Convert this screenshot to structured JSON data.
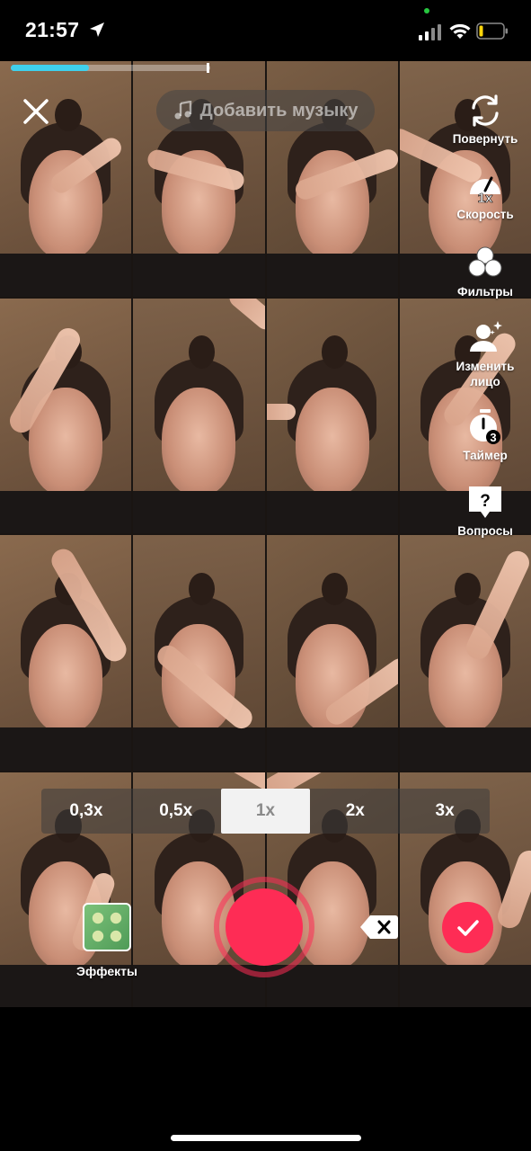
{
  "status_bar": {
    "time": "21:57"
  },
  "recording": {
    "progress_fraction": 0.39
  },
  "top": {
    "music_label": "Добавить музыку"
  },
  "tools": [
    {
      "label": "Повернуть",
      "icon": "flip-camera-icon"
    },
    {
      "label": "Скорость",
      "icon": "speed-icon",
      "badge": "1x"
    },
    {
      "label": "Фильтры",
      "icon": "filters-icon"
    },
    {
      "label": "Изменить лицо",
      "icon": "face-change-icon"
    },
    {
      "label": "Таймер",
      "icon": "timer-icon",
      "badge": "3"
    },
    {
      "label": "Вопросы",
      "icon": "questions-icon",
      "badge": "?"
    }
  ],
  "speed_options": [
    "0,3x",
    "0,5x",
    "1x",
    "2x",
    "3x"
  ],
  "speed_selected": "1x",
  "bottom": {
    "effects_label": "Эффекты"
  },
  "colors": {
    "accent": "#fe2c55",
    "progress": "#3fd0ec"
  }
}
